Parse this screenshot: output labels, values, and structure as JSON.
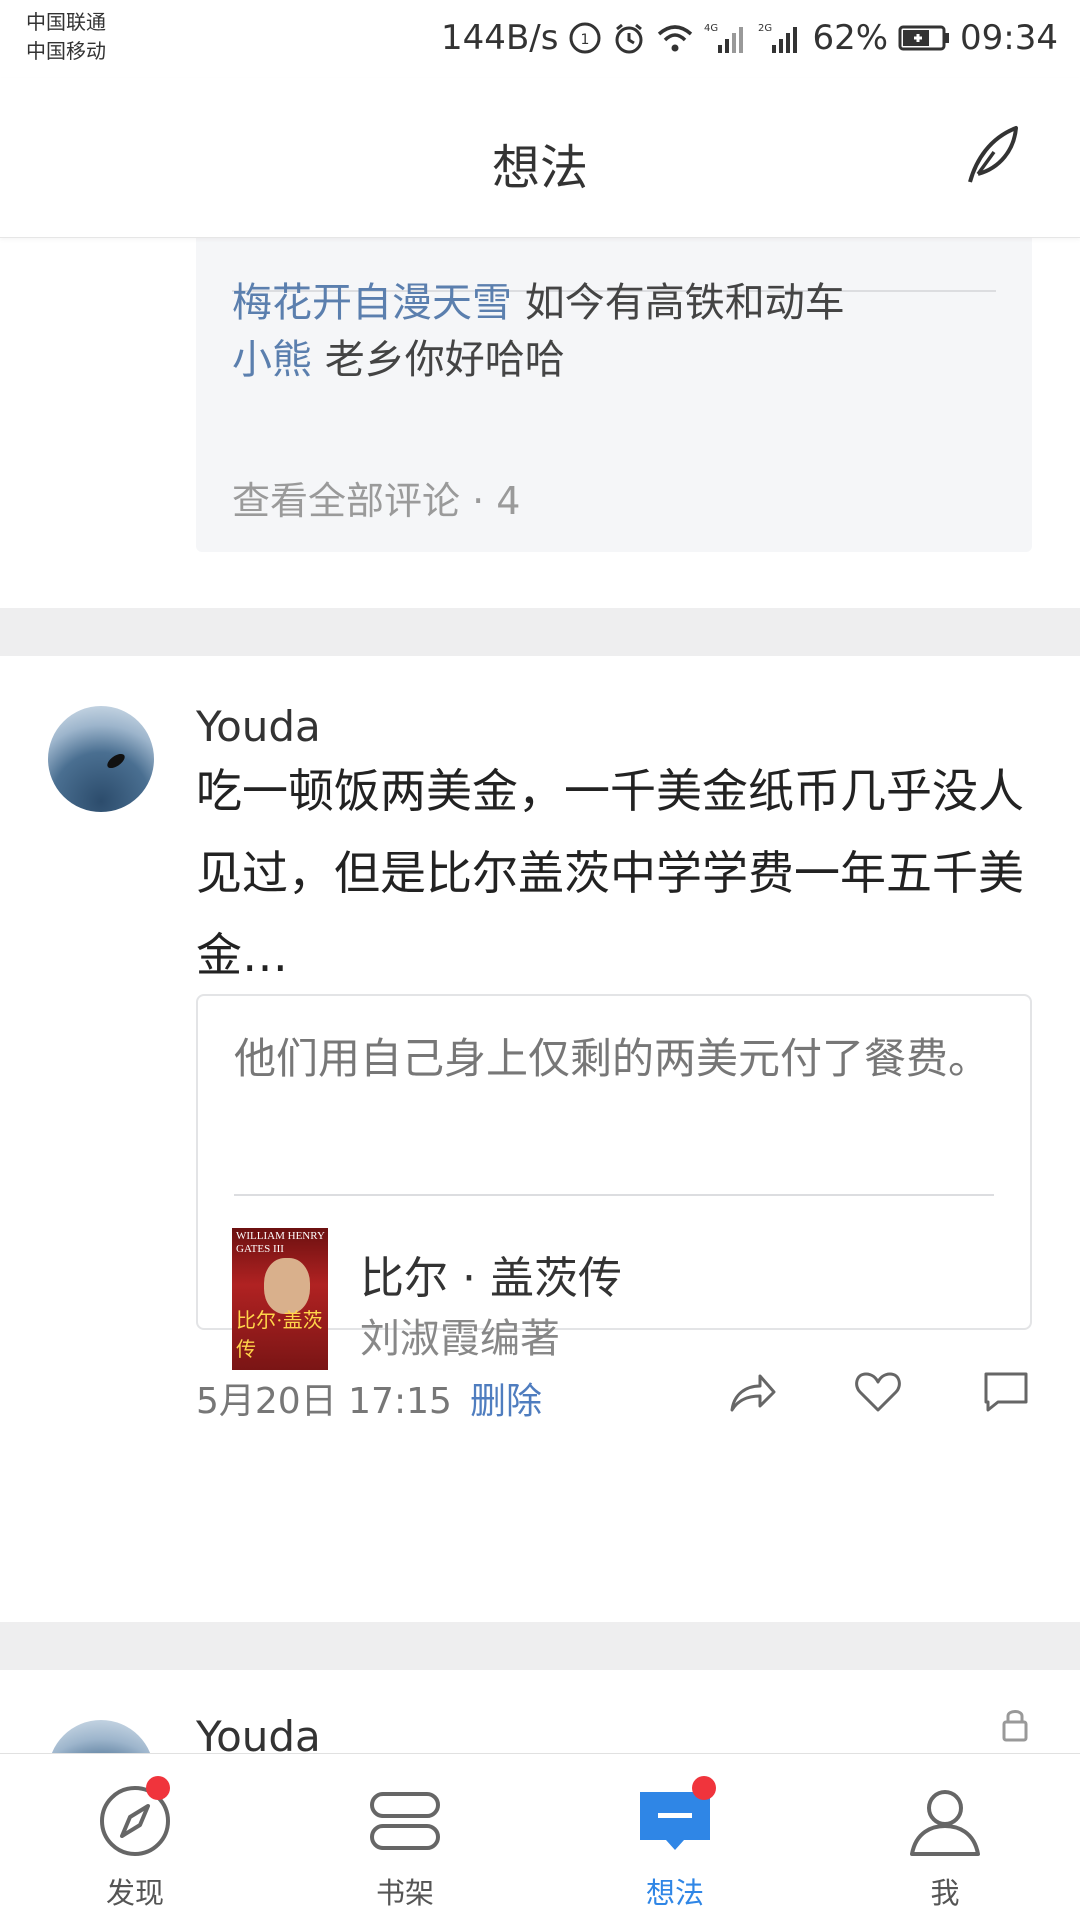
{
  "status_bar": {
    "carrier_1": "中国联通",
    "carrier_2": "中国移动",
    "net_speed": "144B/s",
    "net_4g": "4G",
    "net_2g": "2G",
    "battery": "62%",
    "time": "09:34"
  },
  "header": {
    "title": "想法",
    "compose_icon": "quill-feather-icon"
  },
  "previous_post": {
    "comments": [
      {
        "author": "梅花开自漫天雪",
        "text": "如今有高铁和动车"
      },
      {
        "author": "小熊",
        "text": "老乡你好哈哈"
      }
    ],
    "view_all": "查看全部评论 · 4"
  },
  "post": {
    "username": "Youda",
    "text": "吃一顿饭两美金，一千美金纸币几乎没人见过，但是比尔盖茨中学学费一年五千美金…",
    "quote": "他们用自己身上仅剩的两美元付了餐费。",
    "book": {
      "cover_top": "WILLIAM HENRY GATES III",
      "cover_bottom": "比尔·盖茨传",
      "title": "比尔 · 盖茨传",
      "author": "刘淑霞编著"
    },
    "time": "5月20日 17:15",
    "delete_label": "删除",
    "actions": [
      "share-icon",
      "heart-icon",
      "comment-icon"
    ]
  },
  "next_post": {
    "username": "Youda",
    "lock_icon": "lock-icon"
  },
  "tabs": [
    {
      "label": "发现",
      "icon": "compass-icon",
      "badge": true,
      "active": false
    },
    {
      "label": "书架",
      "icon": "bookshelf-icon",
      "badge": false,
      "active": false
    },
    {
      "label": "想法",
      "icon": "thoughts-icon",
      "badge": true,
      "active": true
    },
    {
      "label": "我",
      "icon": "profile-icon",
      "badge": false,
      "active": false
    }
  ],
  "colors": {
    "accent": "#2f86e6",
    "link": "#4f7dbf",
    "comment_author": "#5b7fae",
    "badge": "#f0343c"
  }
}
